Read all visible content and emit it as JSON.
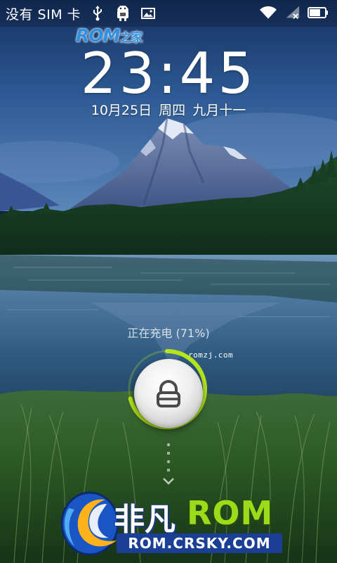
{
  "status_bar": {
    "carrier": "没有 SIM 卡",
    "icons": [
      "usb-icon",
      "android-debug-icon",
      "picture-icon",
      "wifi-icon",
      "signal-no-sim-icon",
      "battery-icon"
    ],
    "battery_level": 0.71
  },
  "watermark_top": {
    "brand": "ROM",
    "suffix": "之家"
  },
  "lockscreen": {
    "time": "23:45",
    "date_month_day": "10月25日",
    "weekday": "周四",
    "lunar_date": "九月十一",
    "charging_status": "正在充电 (71%)",
    "charge_level": 0.71,
    "watermark_site": "romzj.com",
    "unlock_icon": "lock-icon",
    "hint_icon": "chevron-down-icon"
  },
  "watermark_bottom": {
    "name_cn": "非凡",
    "name_rom": "ROM",
    "url": "ROM.CRSKY.COM"
  },
  "colors": {
    "charge_ring": "#b5e61d",
    "rom_green": "#9bdc1a",
    "url_blue": "#1a3f95",
    "logo_blue": "#2f8fe0"
  }
}
